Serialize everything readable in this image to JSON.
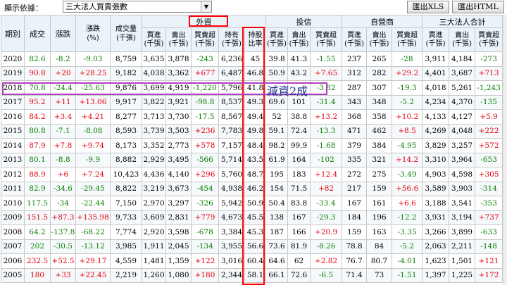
{
  "toolbar": {
    "label": "顯示依據：",
    "select_value": "三大法人買賣張數",
    "xls_button": "匯出XLS",
    "html_button": "匯出HTML"
  },
  "header": {
    "groups": [
      "外資",
      "投信",
      "自營商",
      "三大法人合計"
    ],
    "cols_left": [
      "期別",
      "成交",
      "漲跌",
      "漲跌\n(%)",
      "成交量\n(千張)"
    ],
    "foreign_cols": [
      "買進\n(千張)",
      "賣出\n(千張)",
      "買賣超\n(千張)",
      "持有\n(千張)",
      "持股\n比率"
    ],
    "trust_cols": [
      "買進\n(千張)",
      "賣出\n(千張)",
      "買賣超\n(千張)"
    ],
    "dealer_cols": [
      "買進\n(千張)",
      "賣出\n(千張)",
      "買賣超\n(千張)"
    ],
    "total_cols": [
      "買進\n(千張)",
      "賣出\n(千張)",
      "買賣超\n(千張)"
    ]
  },
  "annotation": "減資2成",
  "colors": {
    "up": "#e8000b",
    "down": "#0a7d00",
    "highlight_box": "#ff0000",
    "row_box": "#b040c0",
    "header_bg": "#eaf3fa"
  },
  "rows": [
    [
      "2020",
      "82.6",
      "-8.2",
      "-9.03",
      "8,759",
      "3,635",
      "3,878",
      "-243",
      "6,236",
      "45",
      "39.8",
      "41.3",
      "-1.55",
      "237",
      "265",
      "-28",
      "3,911",
      "4,184",
      "-273"
    ],
    [
      "2019",
      "90.8",
      "+20",
      "+28.25",
      "9,182",
      "4,038",
      "3,362",
      "+677",
      "6,487",
      "46.8",
      "50.9",
      "43.2",
      "+7.65",
      "312",
      "282",
      "+29.2",
      "4,401",
      "3,687",
      "+713"
    ],
    [
      "2018",
      "70.8",
      "-24.4",
      "-25.63",
      "9,876",
      "3,699",
      "4,919",
      "-1,220",
      "5,796",
      "41.8",
      "",
      "",
      "-3.82",
      "287",
      "307",
      "-19.3",
      "4,018",
      "5,261",
      "-1,243"
    ],
    [
      "2017",
      "95.2",
      "+11",
      "+13.06",
      "9,917",
      "3,822",
      "3,921",
      "-98.8",
      "8,537",
      "49.3",
      "69.6",
      "101",
      "-31.4",
      "343",
      "348",
      "-5.2",
      "4,234",
      "4,370",
      "-135"
    ],
    [
      "2016",
      "84.2",
      "+3.4",
      "+4.21",
      "8,277",
      "3,713",
      "3,730",
      "-17.5",
      "8,567",
      "49.4",
      "52",
      "38.8",
      "+13.2",
      "368",
      "358",
      "+10.2",
      "4,133",
      "4,127",
      "+5.9"
    ],
    [
      "2015",
      "80.8",
      "-7.1",
      "-8.08",
      "8,593",
      "3,739",
      "3,503",
      "+236",
      "7,783",
      "49.8",
      "59.1",
      "72.4",
      "-13.3",
      "471",
      "462",
      "+8.5",
      "4,269",
      "4,048",
      "+222"
    ],
    [
      "2014",
      "87.9",
      "+7.8",
      "+9.74",
      "8,173",
      "3,352",
      "2,773",
      "+578",
      "7,157",
      "48.4",
      "98.2",
      "99.9",
      "-1.68",
      "379",
      "384",
      "-4.95",
      "3,829",
      "3,257",
      "+572"
    ],
    [
      "2013",
      "80.1",
      "-8.8",
      "-9.9",
      "8,882",
      "2,929",
      "3,495",
      "-566",
      "5,714",
      "43.5",
      "61.9",
      "164",
      "-102",
      "335",
      "321",
      "+14.2",
      "3,310",
      "3,964",
      "-653"
    ],
    [
      "2012",
      "88.9",
      "+6",
      "+7.24",
      "10,423",
      "4,436",
      "4,140",
      "+296",
      "5,760",
      "48.7",
      "195",
      "183",
      "+12.4",
      "272",
      "275",
      "-3.49",
      "4,903",
      "4,598",
      "+305"
    ],
    [
      "2011",
      "82.9",
      "-34.6",
      "-29.45",
      "8,822",
      "3,219",
      "3,673",
      "-454",
      "4,938",
      "46.2",
      "154",
      "71.5",
      "+82",
      "217",
      "159",
      "+56.6",
      "3,589",
      "3,903",
      "-314"
    ],
    [
      "2010",
      "117.5",
      "-34",
      "-22.44",
      "7,150",
      "2,970",
      "3,297",
      "-326",
      "5,942",
      "50.9",
      "50.4",
      "83.8",
      "-33.4",
      "167",
      "161",
      "+6.6",
      "3,188",
      "3,541",
      "-353"
    ],
    [
      "2009",
      "151.5",
      "+87.3",
      "+135.98",
      "9,733",
      "3,609",
      "2,831",
      "+779",
      "4,673",
      "45.5",
      "138",
      "167",
      "-29.3",
      "184",
      "196",
      "-12.2",
      "3,931",
      "3,194",
      "+737"
    ],
    [
      "2008",
      "64.2",
      "-137.8",
      "-68.22",
      "7,774",
      "2,920",
      "3,598",
      "-678",
      "3,384",
      "45.3",
      "187",
      "166",
      "+20.9",
      "159",
      "163",
      "-3.35",
      "3,266",
      "3,899",
      "-633"
    ],
    [
      "2007",
      "202",
      "-30.5",
      "-13.12",
      "3,985",
      "1,911",
      "2,045",
      "-134",
      "3,955",
      "56.6",
      "73.6",
      "81.9",
      "-8.26",
      "78.8",
      "84",
      "-5.2",
      "2,063",
      "2,211",
      "-148"
    ],
    [
      "2006",
      "232.5",
      "+52.5",
      "+29.17",
      "4,559",
      "1,481",
      "1,359",
      "+122",
      "3,016",
      "60.4",
      "64.6",
      "62",
      "+2.82",
      "76.7",
      "80.7",
      "-4.01",
      "1,623",
      "1,501",
      "+121"
    ],
    [
      "2005",
      "180",
      "+33",
      "+22.45",
      "2,219",
      "1,260",
      "1,080",
      "+180",
      "2,344",
      "58.1",
      "66.1",
      "72.6",
      "-6.5",
      "71.4",
      "73",
      "-1.51",
      "1,397",
      "1,225",
      "+172"
    ]
  ]
}
